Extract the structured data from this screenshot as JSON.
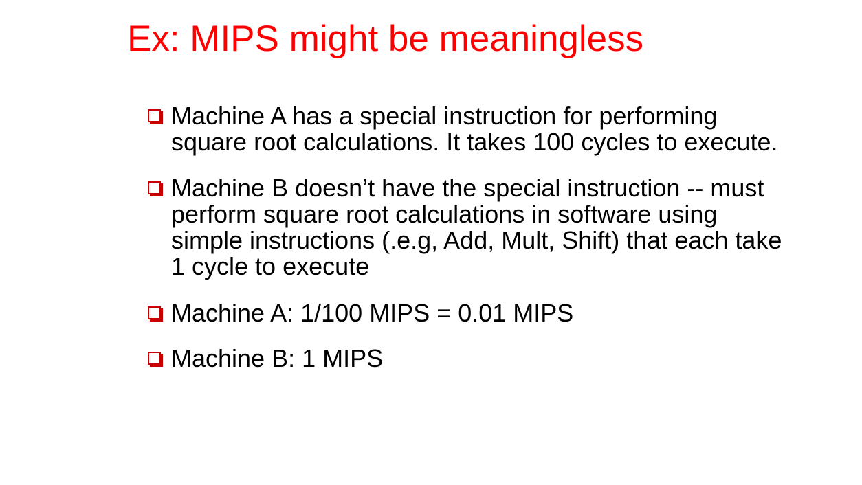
{
  "slide": {
    "title": "Ex: MIPS might be meaningless",
    "colors": {
      "title": "#ff0000",
      "bullet_marker": "#c80000",
      "text": "#000000",
      "background": "#ffffff"
    },
    "bullet_icon": "hollow-square-bullet-icon",
    "bullets": [
      "Machine A has a special instruction for performing square root calculations. It takes 100 cycles to execute.",
      "Machine B doesn’t have the special instruction -- must perform square root calculations in software using simple instructions (.e.g, Add, Mult, Shift) that each take 1 cycle to execute",
      "Machine A: 1/100 MIPS = 0.01 MIPS",
      "Machine B: 1 MIPS"
    ]
  }
}
